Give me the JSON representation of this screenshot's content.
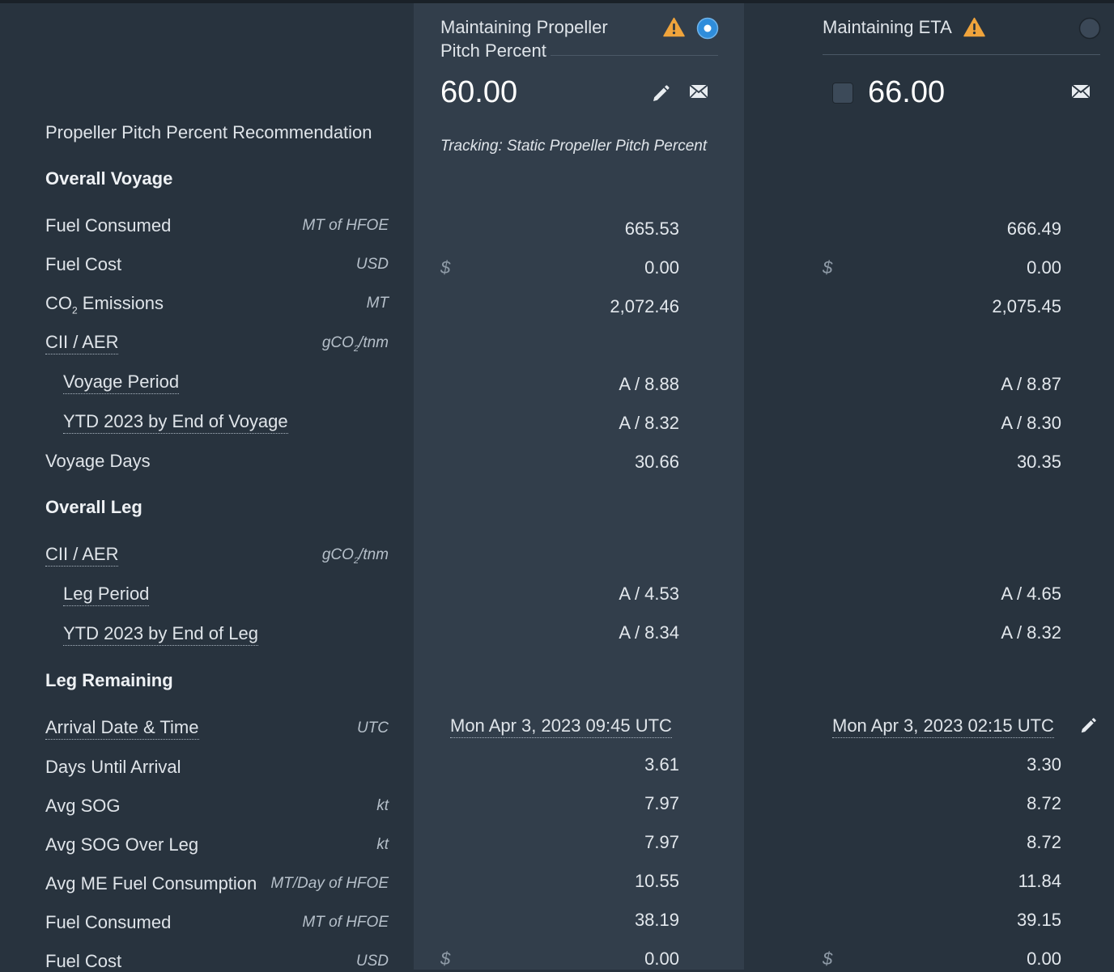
{
  "sidebar": {
    "recommendation_label": "Propeller Pitch Percent Recommendation",
    "overall_voyage": {
      "title": "Overall Voyage",
      "fuel_consumed": {
        "label": "Fuel Consumed",
        "unit": "MT of HFOE"
      },
      "fuel_cost": {
        "label": "Fuel Cost",
        "unit": "USD"
      },
      "co2_emissions": {
        "label_prefix": "CO",
        "label_sub": "2",
        "label_suffix": " Emissions",
        "unit": "MT"
      },
      "cii_aer": {
        "label": "CII / AER",
        "unit_prefix": "gCO",
        "unit_sub": "2",
        "unit_suffix": "/tnm"
      },
      "voyage_period": {
        "label": "Voyage Period"
      },
      "ytd_voyage": {
        "label": "YTD 2023 by End of Voyage"
      },
      "voyage_days": {
        "label": "Voyage Days"
      }
    },
    "overall_leg": {
      "title": "Overall Leg",
      "cii_aer": {
        "label": "CII / AER",
        "unit_prefix": "gCO",
        "unit_sub": "2",
        "unit_suffix": "/tnm"
      },
      "leg_period": {
        "label": "Leg Period"
      },
      "ytd_leg": {
        "label": "YTD 2023 by End of Leg"
      }
    },
    "leg_remaining": {
      "title": "Leg Remaining",
      "arrival": {
        "label": "Arrival Date & Time",
        "unit": "UTC"
      },
      "days_until_arrival": {
        "label": "Days Until Arrival"
      },
      "avg_sog": {
        "label": "Avg SOG",
        "unit": "kt"
      },
      "avg_sog_leg": {
        "label": "Avg SOG Over Leg",
        "unit": "kt"
      },
      "avg_me_fuel": {
        "label": "Avg ME Fuel Consumption",
        "unit": "MT/Day of HFOE"
      },
      "fuel_consumed": {
        "label": "Fuel Consumed",
        "unit": "MT of HFOE"
      },
      "fuel_cost": {
        "label": "Fuel Cost",
        "unit": "USD"
      }
    }
  },
  "columns": [
    {
      "title": "Maintaining Propeller Pitch Percent",
      "selected": true,
      "value": "60.00",
      "tracking": "Tracking: Static Propeller Pitch Percent",
      "voyage_fuel_consumed": "665.53",
      "voyage_fuel_cost_symbol": "$",
      "voyage_fuel_cost": "0.00",
      "voyage_co2": "2,072.46",
      "voyage_period": "A / 8.88",
      "ytd_voyage": "A / 8.32",
      "voyage_days": "30.66",
      "leg_period": "A / 4.53",
      "ytd_leg": "A / 8.34",
      "arrival": "Mon Apr 3, 2023 09:45 UTC",
      "days_until_arrival": "3.61",
      "avg_sog": "7.97",
      "avg_sog_leg": "7.97",
      "avg_me_fuel": "10.55",
      "leg_fuel_consumed": "38.19",
      "leg_fuel_cost_symbol": "$",
      "leg_fuel_cost": "0.00"
    },
    {
      "title": "Maintaining ETA",
      "selected": false,
      "value": "66.00",
      "voyage_fuel_consumed": "666.49",
      "voyage_fuel_cost_symbol": "$",
      "voyage_fuel_cost": "0.00",
      "voyage_co2": "2,075.45",
      "voyage_period": "A / 8.87",
      "ytd_voyage": "A / 8.30",
      "voyage_days": "30.35",
      "leg_period": "A / 4.65",
      "ytd_leg": "A / 8.32",
      "arrival": "Mon Apr 3, 2023 02:15 UTC",
      "days_until_arrival": "3.30",
      "avg_sog": "8.72",
      "avg_sog_leg": "8.72",
      "avg_me_fuel": "11.84",
      "leg_fuel_consumed": "39.15",
      "leg_fuel_cost_symbol": "$",
      "leg_fuel_cost": "0.00"
    }
  ],
  "icons": {
    "warning": "warning-icon",
    "edit": "pencil-icon",
    "email": "envelope-icon",
    "radio": "radio-button"
  },
  "colors": {
    "warning": "#f0a43c",
    "radio_selected": "#2f8ddb",
    "background": "#28333e",
    "highlight_column": "#323e4b"
  }
}
